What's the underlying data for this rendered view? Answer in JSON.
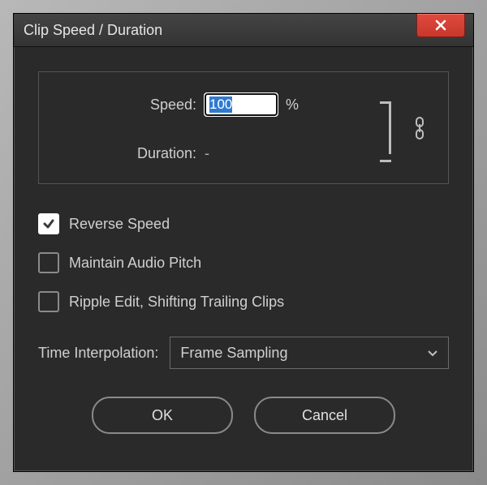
{
  "title": "Clip Speed / Duration",
  "speed": {
    "label": "Speed:",
    "value": "100",
    "unit": "%"
  },
  "duration": {
    "label": "Duration:",
    "value": "-"
  },
  "checkboxes": {
    "reverse": {
      "label": "Reverse Speed",
      "checked": true
    },
    "pitch": {
      "label": "Maintain Audio Pitch",
      "checked": false
    },
    "ripple": {
      "label": "Ripple Edit, Shifting Trailing Clips",
      "checked": false
    }
  },
  "interpolation": {
    "label": "Time Interpolation:",
    "value": "Frame Sampling"
  },
  "buttons": {
    "ok": "OK",
    "cancel": "Cancel"
  }
}
